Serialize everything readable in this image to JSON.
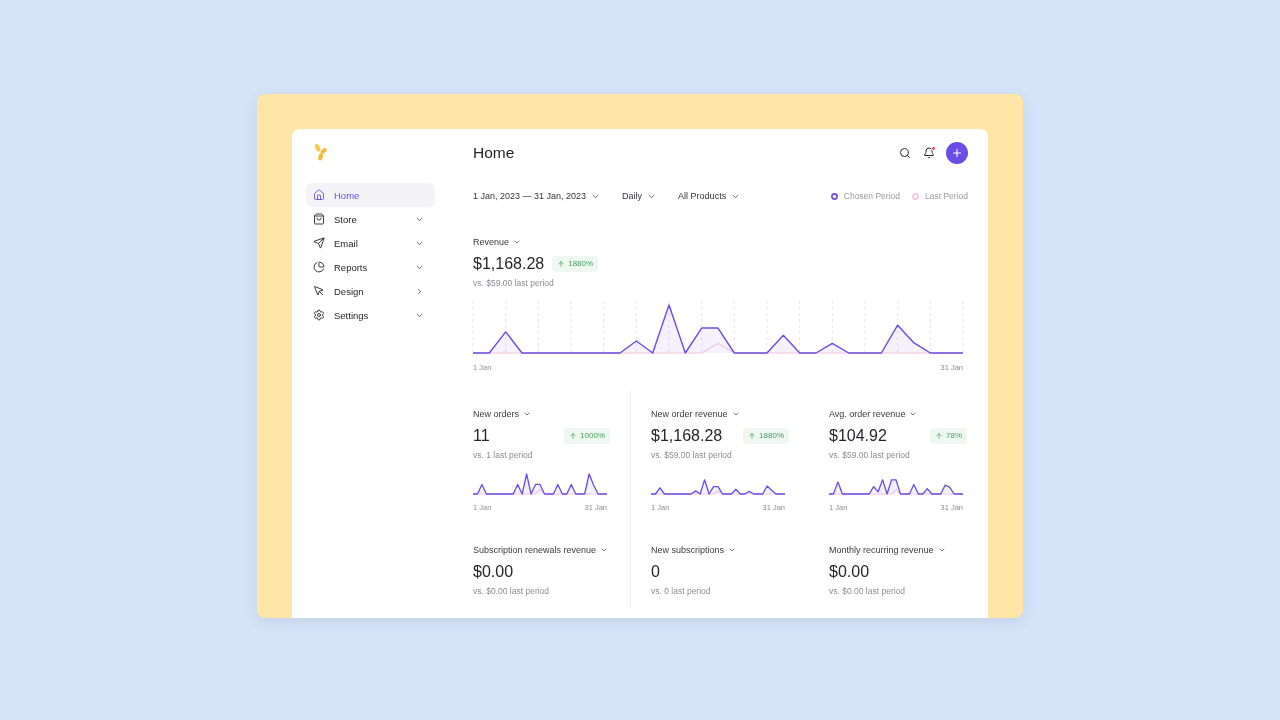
{
  "sidebar": {
    "items": [
      {
        "kind": "link",
        "label": "Home",
        "selected": true
      },
      {
        "kind": "dropdown",
        "label": "Store",
        "selected": false
      },
      {
        "kind": "dropdown",
        "label": "Email",
        "selected": false
      },
      {
        "kind": "dropdown",
        "label": "Reports",
        "selected": false
      },
      {
        "kind": "flyout",
        "label": "Design",
        "selected": false
      },
      {
        "kind": "dropdown",
        "label": "Settings",
        "selected": false
      }
    ]
  },
  "header": {
    "title": "Home",
    "notification": true
  },
  "filters": [
    {
      "label": "1 Jan, 2023 — 31 Jan, 2023"
    },
    {
      "label": "Daily"
    },
    {
      "label": "All Products"
    }
  ],
  "legend": [
    {
      "label": "Chosen Period",
      "color": "#6b4ce6"
    },
    {
      "label": "Last Period",
      "color": "#f3c4dc"
    }
  ],
  "revenue": {
    "title": "Revenue",
    "value": "$1,168.28",
    "change": "1880%",
    "comparison": "vs. $59.00 last period",
    "axis_start": "1 Jan",
    "axis_end": "31 Jan"
  },
  "metrics": [
    {
      "kind": "sparkline",
      "title": "New orders",
      "value": "11",
      "change": "1000%",
      "comparison": "vs. 1 last period",
      "axis_start": "1 Jan",
      "axis_end": "31 Jan"
    },
    {
      "kind": "sparkline",
      "title": "New order revenue",
      "value": "$1,168.28",
      "change": "1880%",
      "comparison": "vs. $59.00 last period",
      "axis_start": "1 Jan",
      "axis_end": "31 Jan"
    },
    {
      "kind": "sparkline",
      "title": "Avg. order revenue",
      "value": "$104.92",
      "change": "78%",
      "comparison": "vs. $59.00 last period",
      "axis_start": "1 Jan",
      "axis_end": "31 Jan"
    },
    {
      "kind": "plain",
      "title": "Subscription renewals revenue",
      "value": "$0.00",
      "comparison": "vs. $0.00 last period"
    },
    {
      "kind": "plain",
      "title": "New subscriptions",
      "value": "0",
      "comparison": "vs. 0 last period"
    },
    {
      "kind": "plain",
      "title": "Monthly recurring revenue",
      "value": "$0.00",
      "comparison": "vs. $0.00 last period"
    }
  ]
}
